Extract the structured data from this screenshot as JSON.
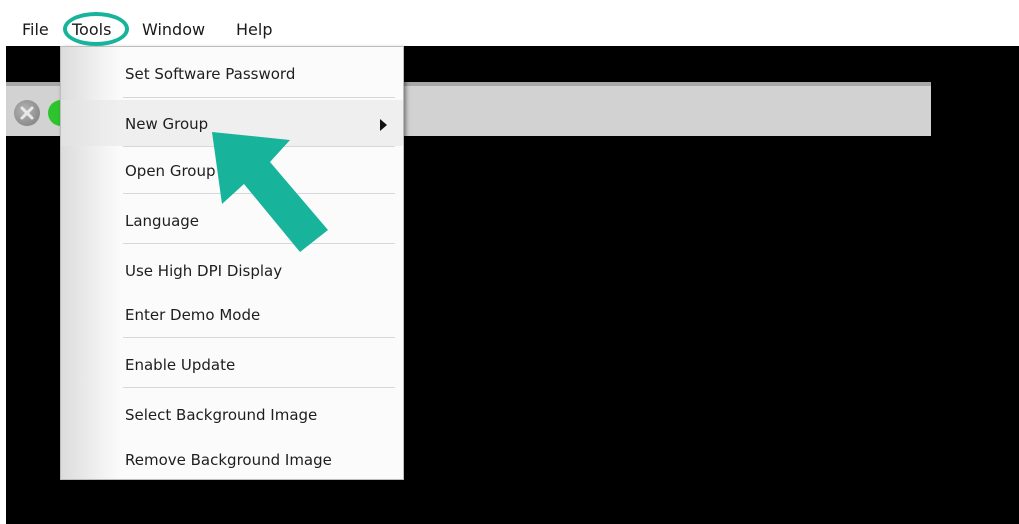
{
  "menubar": {
    "items": [
      {
        "label": "File"
      },
      {
        "label": "Tools"
      },
      {
        "label": "Window"
      },
      {
        "label": "Help"
      }
    ]
  },
  "tools_menu": {
    "items": [
      {
        "label": "Set Software Password"
      },
      {
        "label": "New Group",
        "has_submenu": true
      },
      {
        "label": "Open Group"
      },
      {
        "label": "Language"
      },
      {
        "label": "Use High DPI Display"
      },
      {
        "label": "Enter Demo Mode"
      },
      {
        "label": "Enable Update"
      },
      {
        "label": "Select Background Image"
      },
      {
        "label": "Remove Background Image"
      }
    ]
  },
  "annotation": {
    "color": "#17b39b",
    "highlight_target": "Tools",
    "arrow_target": "New Group",
    "arrow_icon": "arrow-up-left-icon"
  },
  "colors": {
    "workspace": "#000000",
    "menubar": "#ffffff",
    "menu_background": "#fbfbfb",
    "status_green": "#2ec42e"
  }
}
